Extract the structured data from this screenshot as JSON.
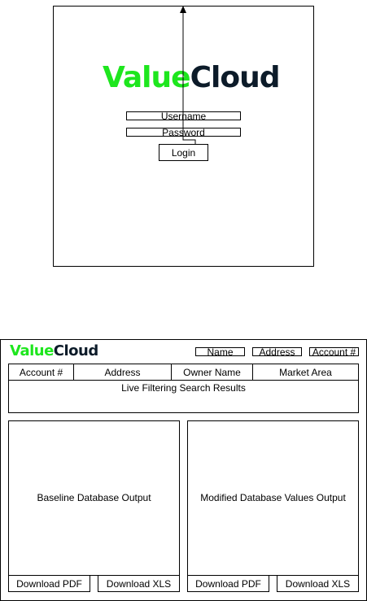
{
  "login": {
    "logo_part1": "Value",
    "logo_part2": "Cloud",
    "username_label": "Username",
    "password_label": "Password",
    "login_button": "Login"
  },
  "dashboard": {
    "logo_part1": "Value",
    "logo_part2": "Cloud",
    "search_fields": [
      "Name",
      "Address",
      "Account #"
    ],
    "columns": [
      "Account #",
      "Address",
      "Owner Name",
      "Market Area"
    ],
    "results_label": "Live Filtering Search Results",
    "baseline_label": "Baseline Database Output",
    "modified_label": "Modified Database Values Output",
    "baseline_pdf": "Download PDF",
    "baseline_xls": "Download XLS",
    "modified_pdf": "Download PDF",
    "modified_xls": "Download XLS"
  },
  "colors": {
    "logo_green": "#1ee61e",
    "logo_dark": "#0c1b29"
  }
}
